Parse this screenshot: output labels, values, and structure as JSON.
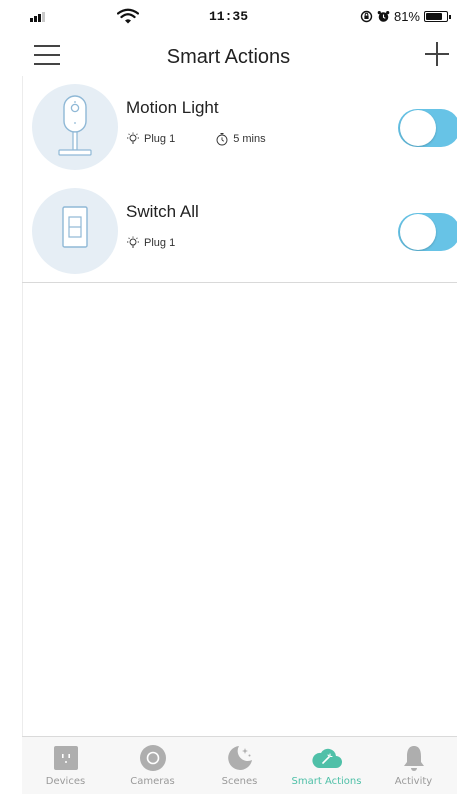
{
  "status_bar": {
    "time": "11:35",
    "battery": "81%",
    "battery_level": 0.81
  },
  "nav": {
    "title": "Smart Actions",
    "menu_icon": "hamburger-menu-icon",
    "add_icon": "plus-icon"
  },
  "actions": [
    {
      "name": "Motion Light",
      "device_icon": "camera-icon",
      "trigger": "Plug 1",
      "trigger_icon": "light-bulb-icon",
      "duration": "5 mins",
      "duration_icon": "stopwatch-icon",
      "enabled": true
    },
    {
      "name": "Switch All",
      "device_icon": "light-switch-icon",
      "trigger": "Plug 1",
      "trigger_icon": "light-bulb-icon",
      "enabled": true
    }
  ],
  "tabs": [
    {
      "label": "Devices",
      "icon": "plug-icon",
      "active": false
    },
    {
      "label": "Cameras",
      "icon": "camera-lens-icon",
      "active": false
    },
    {
      "label": "Scenes",
      "icon": "moon-stars-icon",
      "active": false
    },
    {
      "label": "Smart Actions",
      "icon": "cloud-wand-icon",
      "active": true
    },
    {
      "label": "Activity",
      "icon": "bell-icon",
      "active": false
    }
  ],
  "colors": {
    "toggle_on": "#67c3e6",
    "accent_active": "#4fc0a8",
    "tab_inactive": "#9a9a9a",
    "avatar_bg": "#e6eef5"
  }
}
